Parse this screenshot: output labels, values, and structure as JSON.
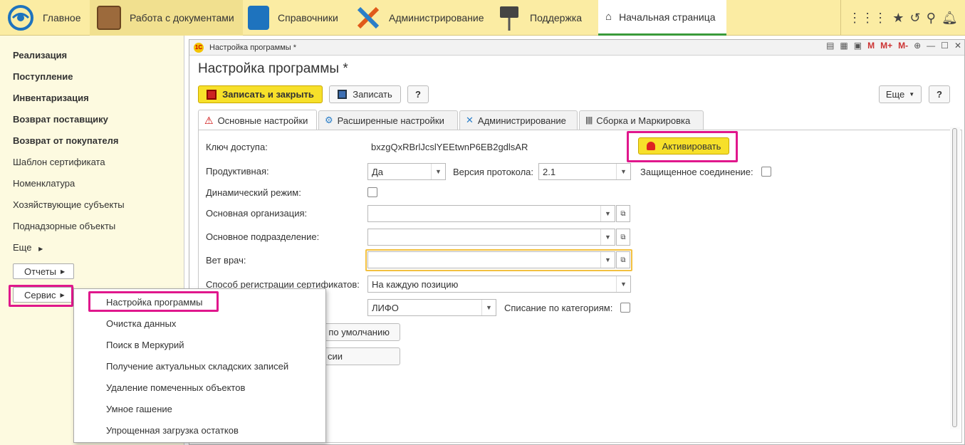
{
  "topbar": {
    "items": [
      {
        "label": "Главное",
        "icon": "app-logo-icon"
      },
      {
        "label": "Работа с документами",
        "icon": "briefcase-icon"
      },
      {
        "label": "Справочники",
        "icon": "phonebook-icon"
      },
      {
        "label": "Администрирование",
        "icon": "tools-icon"
      },
      {
        "label": "Поддержка",
        "icon": "help-sign-icon"
      }
    ],
    "home_tab": "Начальная страница",
    "right_icons": [
      "grid-icon",
      "star-icon",
      "history-icon",
      "search-icon",
      "bell-icon"
    ]
  },
  "sidebar": {
    "items": [
      {
        "label": "Реализация",
        "bold": true
      },
      {
        "label": "Поступление",
        "bold": true
      },
      {
        "label": "Инвентаризация",
        "bold": true
      },
      {
        "label": "Возврат поставщику",
        "bold": true
      },
      {
        "label": "Возврат от покупателя",
        "bold": true
      },
      {
        "label": "Шаблон сертификата",
        "bold": false
      },
      {
        "label": "Номенклатура",
        "bold": false
      },
      {
        "label": "Хозяйствующие субъекты",
        "bold": false
      },
      {
        "label": "Поднадзорные объекты",
        "bold": false
      },
      {
        "label": "Еще",
        "bold": false
      }
    ],
    "reports_button": "Отчеты",
    "service_button": "Сервис"
  },
  "popup_menu": {
    "items": [
      "Настройка программы",
      "Очистка данных",
      "Поиск в Меркурий",
      "Получение актуальных складских записей",
      "Удаление помеченных объектов",
      "Умное гашение",
      "Упрощенная загрузка остатков"
    ]
  },
  "window": {
    "title": "Настройка программы *",
    "logo_text": "1С",
    "ctrl": {
      "m": "M",
      "mplus": "M+",
      "mminus": "M-"
    },
    "form_title": "Настройка программы *",
    "toolbar": {
      "save_close": "Записать и закрыть",
      "save": "Записать",
      "help": "?",
      "more": "Еще",
      "help2": "?"
    },
    "tabs": [
      "Основные настройки",
      "Расширенные настройки",
      "Администрирование",
      "Сборка и Маркировка"
    ],
    "fields": {
      "access_key_label": "Ключ доступа:",
      "access_key_value": "bxzgQxRBrlJcslYEEtwnP6EB2gdlsAR",
      "activate_button": "Активировать",
      "productive_label": "Продуктивная:",
      "productive_value": "Да",
      "protocol_label": "Версия протокола:",
      "protocol_value": "2.1",
      "secure_label": "Защищенное соединение:",
      "dynamic_label": "Динамический режим:",
      "org_label": "Основная организация:",
      "org_value": "",
      "subdiv_label": "Основное подразделение:",
      "subdiv_value": "",
      "vet_label": "Вет врач:",
      "vet_value": "",
      "cert_reg_label": "Способ регистрации сертификатов:",
      "cert_reg_value": "На каждую позицию",
      "method_value": "ЛИФО",
      "writeoff_label": "Списание по категориям:",
      "default_button_tail": "по умолчанию",
      "version_button_tail": "сии"
    }
  }
}
